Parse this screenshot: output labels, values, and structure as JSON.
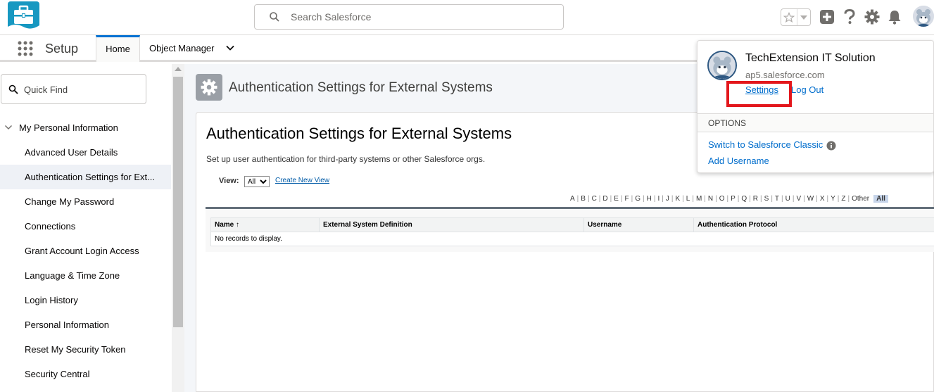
{
  "header": {
    "search_placeholder": "Search Salesforce",
    "brand_color": "#1798c1",
    "icons": [
      "favorites-star-icon",
      "chevron-down-icon",
      "global-create-icon",
      "help-icon",
      "setup-gear-icon",
      "notifications-bell-icon",
      "avatar"
    ]
  },
  "tabbar": {
    "app_name": "Setup",
    "tabs": [
      {
        "label": "Home",
        "active": true
      },
      {
        "label": "Object Manager",
        "active": false
      }
    ]
  },
  "sidebar": {
    "quick_find_placeholder": "Quick Find",
    "section": "My Personal Information",
    "items": [
      {
        "label": "Advanced User Details"
      },
      {
        "label": "Authentication Settings for Ext...",
        "active": true
      },
      {
        "label": "Change My Password"
      },
      {
        "label": "Connections"
      },
      {
        "label": "Grant Account Login Access"
      },
      {
        "label": "Language & Time Zone"
      },
      {
        "label": "Login History"
      },
      {
        "label": "Personal Information"
      },
      {
        "label": "Reset My Security Token"
      },
      {
        "label": "Security Central"
      }
    ]
  },
  "page": {
    "header_title": "Authentication Settings for External Systems",
    "heading": "Authentication Settings for External Systems",
    "description": "Set up user authentication for third-party systems or other Salesforce orgs.",
    "view_label": "View:",
    "view_value": "All",
    "create_new_view": "Create New View",
    "alphabet": [
      "A",
      "B",
      "C",
      "D",
      "E",
      "F",
      "G",
      "H",
      "I",
      "J",
      "K",
      "L",
      "M",
      "N",
      "O",
      "P",
      "Q",
      "R",
      "S",
      "T",
      "U",
      "V",
      "W",
      "X",
      "Y",
      "Z",
      "Other"
    ],
    "alphabet_all": "All",
    "table": {
      "columns": [
        "Name ↑",
        "External System Definition",
        "Username",
        "Authentication Protocol"
      ],
      "empty_message": "No records to display."
    }
  },
  "profile_popup": {
    "org_name": "TechExtension IT Solution",
    "domain": "ap5.salesforce.com",
    "settings_label": "Settings",
    "logout_label": "Log Out",
    "options_header": "OPTIONS",
    "switch_classic": "Switch to Salesforce Classic",
    "add_username": "Add Username",
    "highlight_color": "#e3171c"
  }
}
